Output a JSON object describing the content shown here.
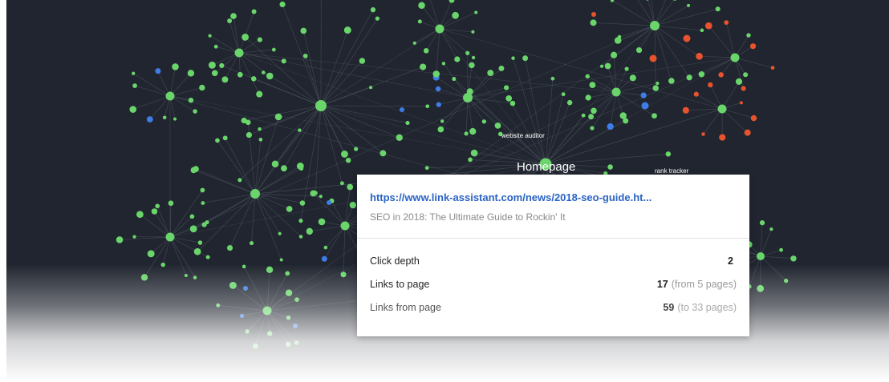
{
  "graph": {
    "labels": {
      "homepage": "Homepage",
      "website_auditor": "website auditor",
      "rank_tracker": "rank tracker"
    },
    "colors": {
      "background": "#20252f",
      "node_green": "#6ad56b",
      "node_red": "#e8532e",
      "node_blue": "#3e7de8",
      "edge": "#5d6470"
    }
  },
  "tooltip": {
    "url": "https://www.link-assistant.com/news/2018-seo-guide.ht...",
    "page_title": "SEO in 2018: The Ultimate Guide to Rockin' It",
    "stats": [
      {
        "label": "Click depth",
        "value": "2",
        "note": ""
      },
      {
        "label": "Links to page",
        "value": "17",
        "note": "(from 5 pages)"
      },
      {
        "label": "Links from page",
        "value": "59",
        "note": "(to 33 pages)"
      }
    ]
  }
}
